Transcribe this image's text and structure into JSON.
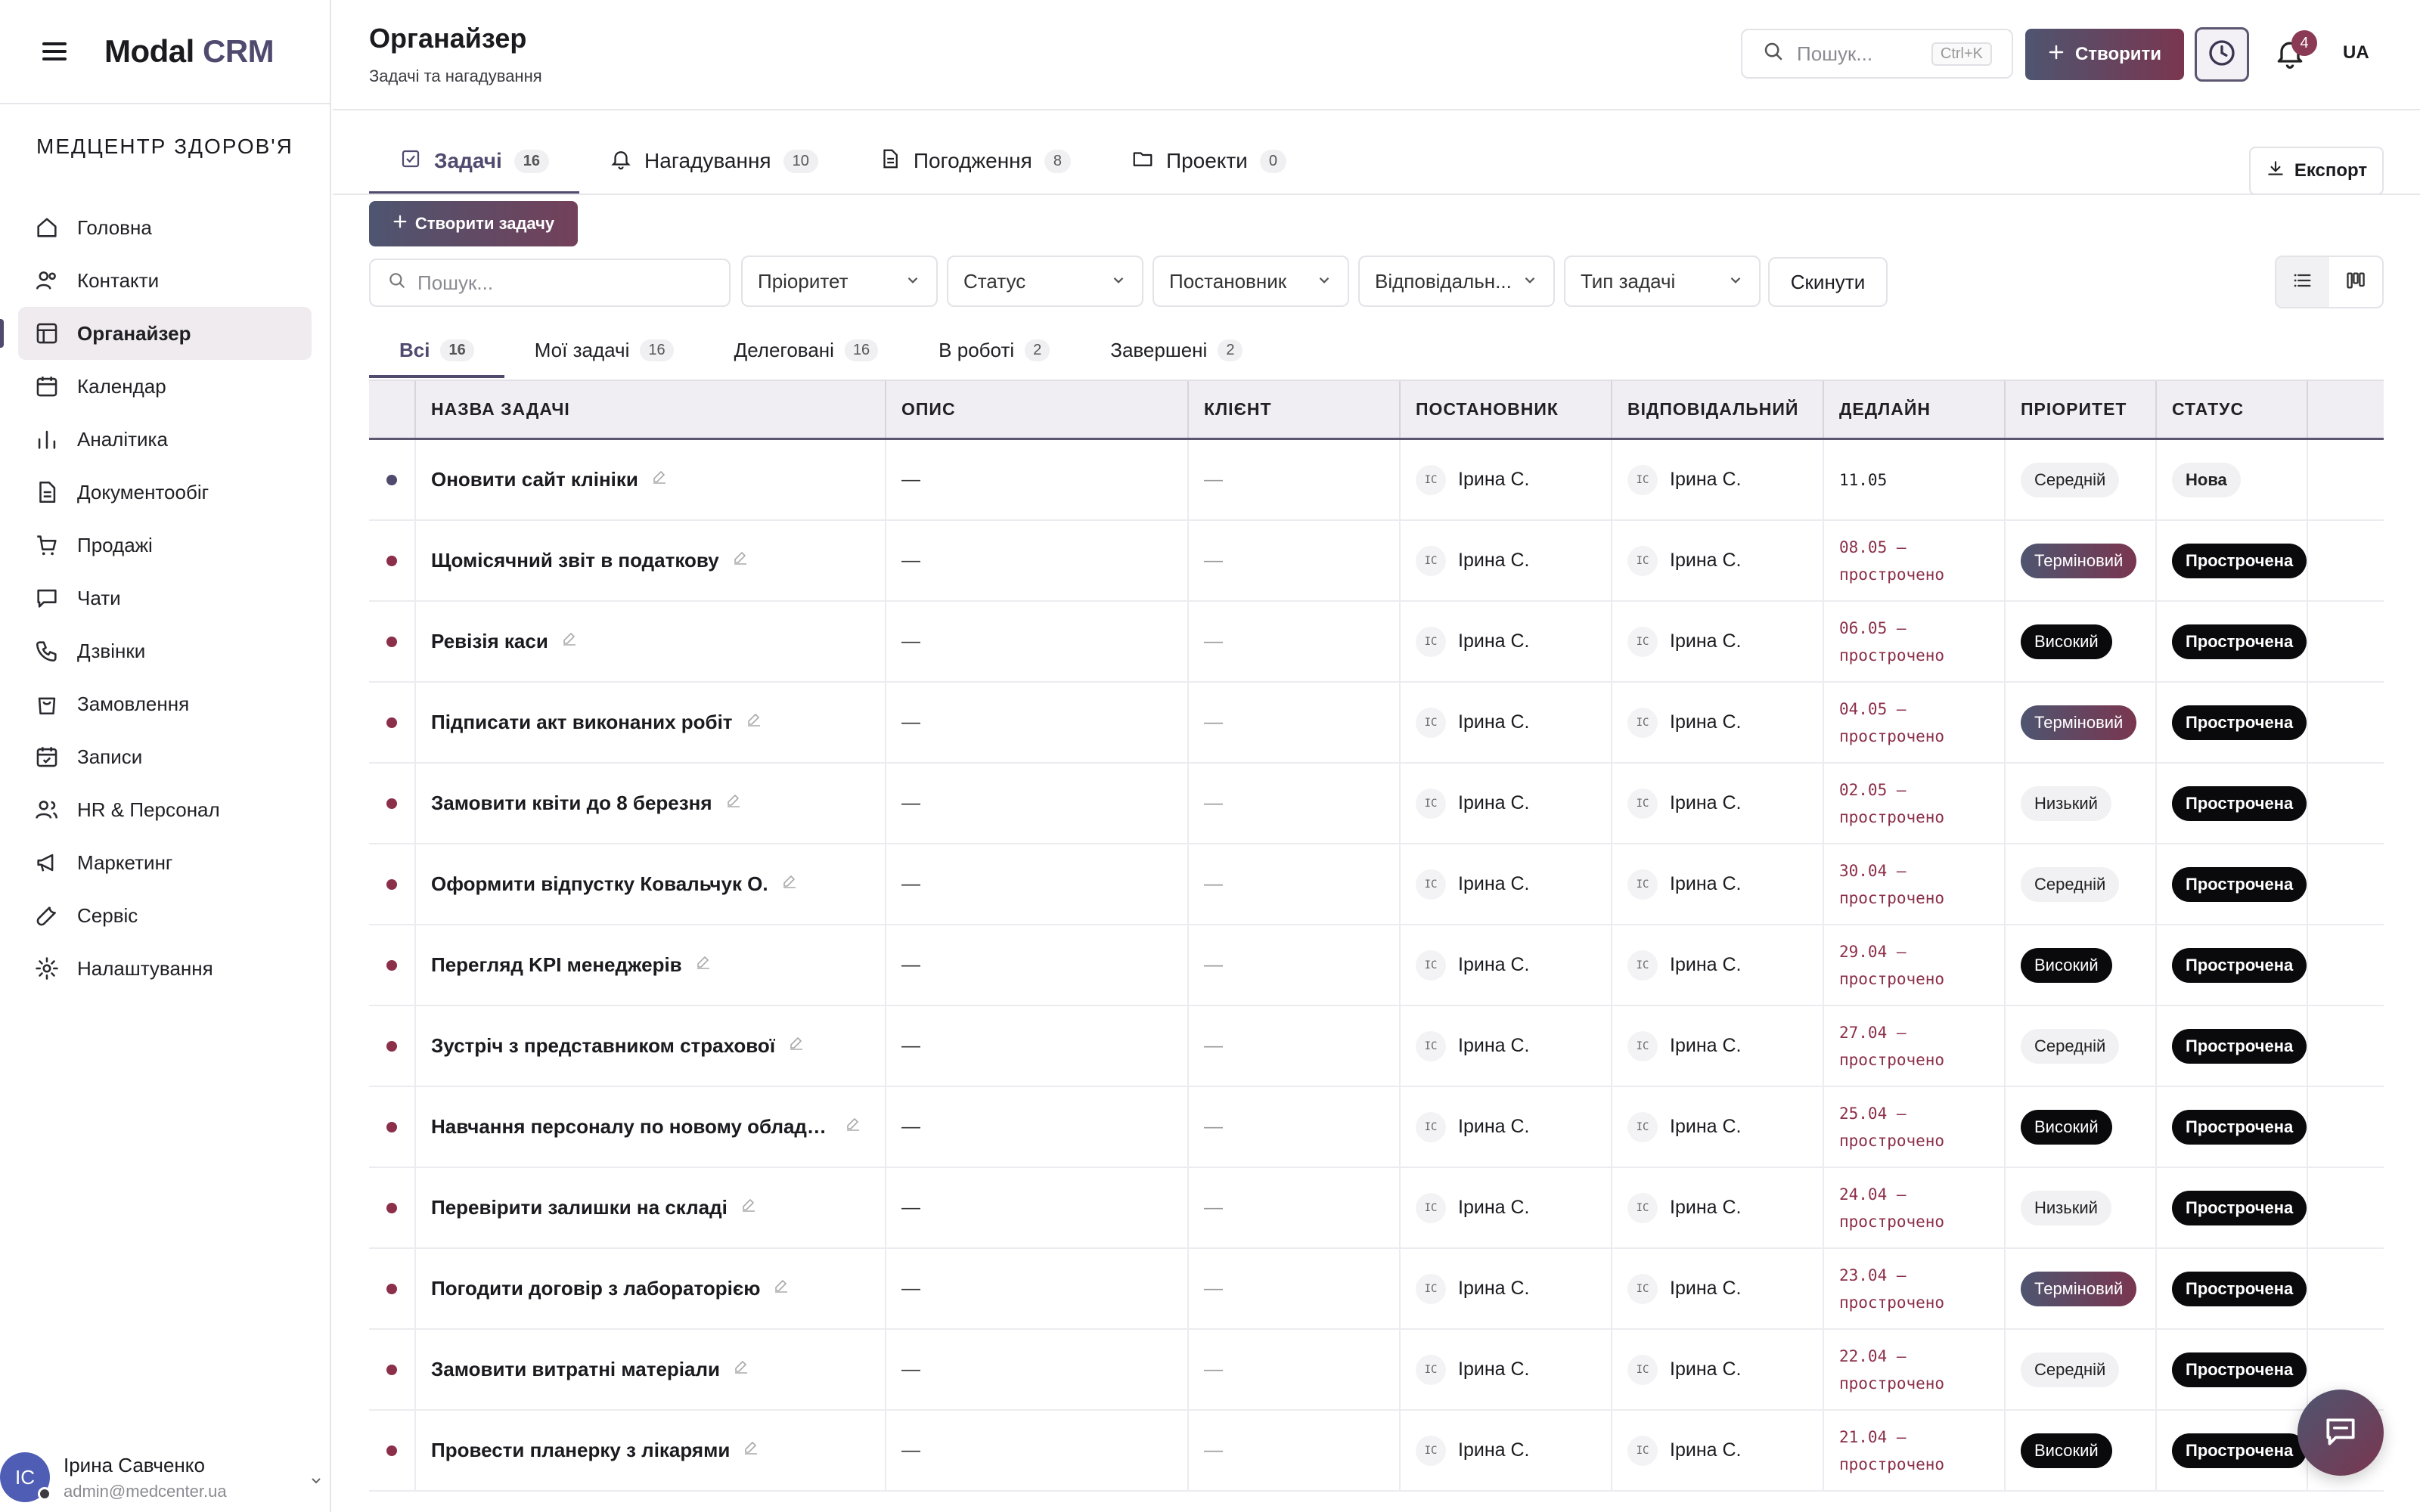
{
  "app": {
    "logo_main": "Modal",
    "logo_accent": "CRM",
    "org": "МЕДЦЕНТР ЗДОРОВ'Я"
  },
  "sidebar": {
    "items": [
      {
        "label": "Головна",
        "icon": "home-icon"
      },
      {
        "label": "Контакти",
        "icon": "users-icon"
      },
      {
        "label": "Органайзер",
        "icon": "layout-icon",
        "active": true
      },
      {
        "label": "Календар",
        "icon": "calendar-icon"
      },
      {
        "label": "Аналітика",
        "icon": "bar-chart-icon"
      },
      {
        "label": "Документообіг",
        "icon": "document-icon"
      },
      {
        "label": "Продажі",
        "icon": "cart-icon"
      },
      {
        "label": "Чати",
        "icon": "chat-icon"
      },
      {
        "label": "Дзвінки",
        "icon": "phone-icon"
      },
      {
        "label": "Замовлення",
        "icon": "bag-icon"
      },
      {
        "label": "Записи",
        "icon": "calendar-check-icon"
      },
      {
        "label": "HR & Персонал",
        "icon": "team-icon"
      },
      {
        "label": "Маркетинг",
        "icon": "megaphone-icon"
      },
      {
        "label": "Сервіс",
        "icon": "wrench-icon"
      },
      {
        "label": "Налаштування",
        "icon": "gear-icon"
      }
    ],
    "user": {
      "initials": "IC",
      "name": "Ірина Савченко",
      "email": "admin@medcenter.ua"
    }
  },
  "header": {
    "title": "Органайзер",
    "subtitle": "Задачі та нагадування",
    "search_placeholder": "Пошук...",
    "search_shortcut": "Ctrl+K",
    "create_label": "Створити",
    "notifications": "4",
    "lang": "UA"
  },
  "main_tabs": [
    {
      "label": "Задачі",
      "count": "16",
      "active": true
    },
    {
      "label": "Нагадування",
      "count": "10"
    },
    {
      "label": "Погодження",
      "count": "8"
    },
    {
      "label": "Проекти",
      "count": "0"
    }
  ],
  "export_label": "Експорт",
  "toolbar": {
    "create_task": "Створити задачу",
    "search_placeholder": "Пошук...",
    "filters": [
      "Пріоритет",
      "Статус",
      "Постановник",
      "Відповідальн...",
      "Тип задачі"
    ],
    "reset": "Скинути"
  },
  "sub_tabs": [
    {
      "label": "Всі",
      "count": "16",
      "active": true
    },
    {
      "label": "Мої задачі",
      "count": "16"
    },
    {
      "label": "Делеговані",
      "count": "16"
    },
    {
      "label": "В роботі",
      "count": "2"
    },
    {
      "label": "Завершені",
      "count": "2"
    }
  ],
  "table": {
    "headers": [
      "НАЗВА ЗАДАЧІ",
      "ОПИС",
      "КЛІЄНТ",
      "ПОСТАНОВНИК",
      "ВІДПОВІДАЛЬНИЙ",
      "ДЕДЛАЙН",
      "ПРІОРИТЕТ",
      "СТАТУС"
    ],
    "rows": [
      {
        "name": "Оновити сайт клініки",
        "desc": "—",
        "client": "—",
        "author": "Ірина С.",
        "owner": "Ірина С.",
        "deadline": "11.05",
        "overdue": false,
        "priority": "Середній",
        "pclass": "p-mid",
        "status": "Нова",
        "sclass": "s-new",
        "dot": "#4f4a6e"
      },
      {
        "name": "Щомісячний звіт в податкову",
        "desc": "—",
        "client": "—",
        "author": "Ірина С.",
        "owner": "Ірина С.",
        "deadline": "08.05 — прострочено",
        "overdue": true,
        "priority": "Терміновий",
        "pclass": "p-urg",
        "status": "Прострочена",
        "sclass": "s-over",
        "dot": "#8b2f4a"
      },
      {
        "name": "Ревізія каси",
        "desc": "—",
        "client": "—",
        "author": "Ірина С.",
        "owner": "Ірина С.",
        "deadline": "06.05 — прострочено",
        "overdue": true,
        "priority": "Високий",
        "pclass": "p-high",
        "status": "Прострочена",
        "sclass": "s-over",
        "dot": "#8b2f4a"
      },
      {
        "name": "Підписати акт виконаних робіт",
        "desc": "—",
        "client": "—",
        "author": "Ірина С.",
        "owner": "Ірина С.",
        "deadline": "04.05 — прострочено",
        "overdue": true,
        "priority": "Терміновий",
        "pclass": "p-urg",
        "status": "Прострочена",
        "sclass": "s-over",
        "dot": "#8b2f4a"
      },
      {
        "name": "Замовити квіти до 8 березня",
        "desc": "—",
        "client": "—",
        "author": "Ірина С.",
        "owner": "Ірина С.",
        "deadline": "02.05 — прострочено",
        "overdue": true,
        "priority": "Низький",
        "pclass": "p-low",
        "status": "Прострочена",
        "sclass": "s-over",
        "dot": "#8b2f4a"
      },
      {
        "name": "Оформити відпустку Ковальчук О.",
        "desc": "—",
        "client": "—",
        "author": "Ірина С.",
        "owner": "Ірина С.",
        "deadline": "30.04 — прострочено",
        "overdue": true,
        "priority": "Середній",
        "pclass": "p-mid",
        "status": "Прострочена",
        "sclass": "s-over",
        "dot": "#8b2f4a"
      },
      {
        "name": "Перегляд KPI менеджерів",
        "desc": "—",
        "client": "—",
        "author": "Ірина С.",
        "owner": "Ірина С.",
        "deadline": "29.04 — прострочено",
        "overdue": true,
        "priority": "Високий",
        "pclass": "p-high",
        "status": "Прострочена",
        "sclass": "s-over",
        "dot": "#8b2f4a"
      },
      {
        "name": "Зустріч з представником страхової",
        "desc": "—",
        "client": "—",
        "author": "Ірина С.",
        "owner": "Ірина С.",
        "deadline": "27.04 — прострочено",
        "overdue": true,
        "priority": "Середній",
        "pclass": "p-mid",
        "status": "Прострочена",
        "sclass": "s-over",
        "dot": "#8b2f4a"
      },
      {
        "name": "Навчання персоналу по новому обладн...",
        "desc": "—",
        "client": "—",
        "author": "Ірина С.",
        "owner": "Ірина С.",
        "deadline": "25.04 — прострочено",
        "overdue": true,
        "priority": "Високий",
        "pclass": "p-high",
        "status": "Прострочена",
        "sclass": "s-over",
        "dot": "#8b2f4a"
      },
      {
        "name": "Перевірити залишки на складі",
        "desc": "—",
        "client": "—",
        "author": "Ірина С.",
        "owner": "Ірина С.",
        "deadline": "24.04 — прострочено",
        "overdue": true,
        "priority": "Низький",
        "pclass": "p-low",
        "status": "Прострочена",
        "sclass": "s-over",
        "dot": "#8b2f4a"
      },
      {
        "name": "Погодити договір з лабораторією",
        "desc": "—",
        "client": "—",
        "author": "Ірина С.",
        "owner": "Ірина С.",
        "deadline": "23.04 — прострочено",
        "overdue": true,
        "priority": "Терміновий",
        "pclass": "p-urg",
        "status": "Прострочена",
        "sclass": "s-over",
        "dot": "#8b2f4a"
      },
      {
        "name": "Замовити витратні матеріали",
        "desc": "—",
        "client": "—",
        "author": "Ірина С.",
        "owner": "Ірина С.",
        "deadline": "22.04 — прострочено",
        "overdue": true,
        "priority": "Середній",
        "pclass": "p-mid",
        "status": "Прострочена",
        "sclass": "s-over",
        "dot": "#8b2f4a"
      },
      {
        "name": "Провести планерку з лікарями",
        "desc": "—",
        "client": "—",
        "author": "Ірина С.",
        "owner": "Ірина С.",
        "deadline": "21.04 — прострочено",
        "overdue": true,
        "priority": "Високий",
        "pclass": "p-high",
        "status": "Прострочена",
        "sclass": "s-over",
        "dot": "#8b2f4a"
      }
    ],
    "avatar_initials": "IC"
  },
  "colors": {
    "accent": "#4f4a6e",
    "danger": "#8b2f4a",
    "brand_gradient_start": "#4e5570",
    "brand_gradient_end": "#7a3650"
  }
}
